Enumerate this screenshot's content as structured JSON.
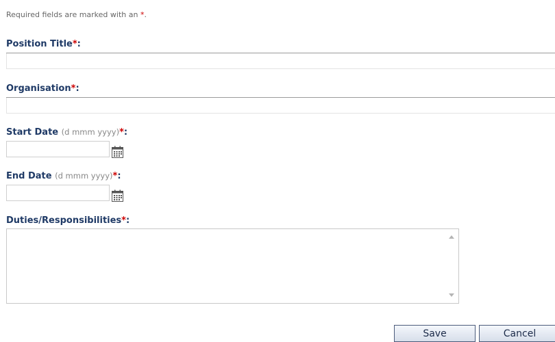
{
  "form": {
    "required_note_prefix": "Required fields are marked with an ",
    "required_marker": "*",
    "required_note_suffix": ".",
    "fields": {
      "position_title": {
        "label": "Position Title",
        "value": ""
      },
      "organisation": {
        "label": "Organisation",
        "value": ""
      },
      "start_date": {
        "label": "Start Date",
        "hint": "(d mmm yyyy)",
        "value": ""
      },
      "end_date": {
        "label": "End Date",
        "hint": "(d mmm yyyy)",
        "value": ""
      },
      "duties": {
        "label": "Duties/Responsibilities",
        "value": ""
      }
    },
    "label_suffix": ":"
  },
  "actions": {
    "save_label": "Save",
    "cancel_label": "Cancel"
  },
  "icons": {
    "date_picker": "calendar-icon",
    "scroll_up": "scroll-up-arrow-icon",
    "scroll_down": "scroll-down-arrow-icon"
  },
  "colors": {
    "label": "#1f3a66",
    "required": "#cc0000",
    "hint": "#888888",
    "button_border": "#4a5a7a"
  }
}
